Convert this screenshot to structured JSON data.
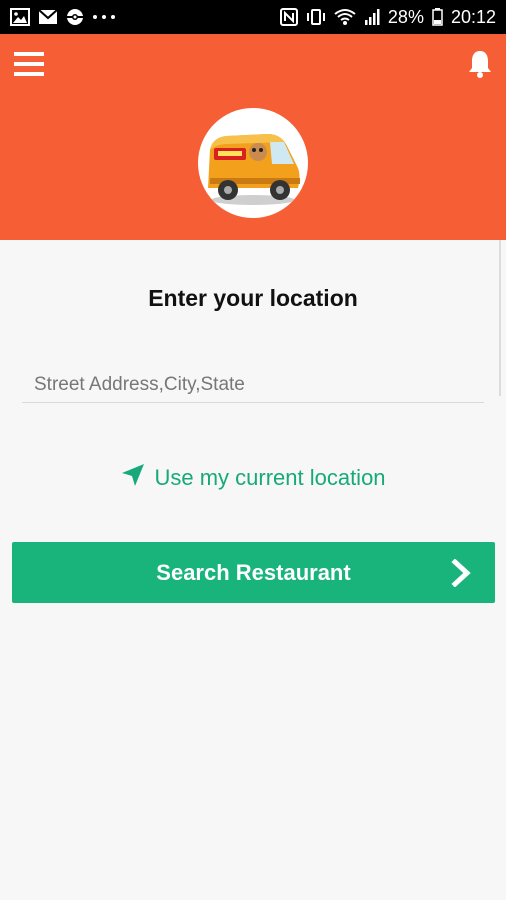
{
  "status_bar": {
    "icons_left": [
      "gallery-icon",
      "mail-icon",
      "pokeball-icon",
      "more-icon"
    ],
    "icons_right": [
      "nfc-icon",
      "vibrate-icon",
      "wifi-icon",
      "signal-icon",
      "battery-icon"
    ],
    "battery": "28%",
    "time": "20:12"
  },
  "header": {
    "background": "#f65f36",
    "menu_icon": "hamburger-menu-icon",
    "notification_icon": "bell-icon",
    "logo": "food-delivery-van-logo"
  },
  "main": {
    "title": "Enter your location",
    "address_input": {
      "value": "",
      "placeholder": "Street Address,City,State"
    },
    "current_location_link": {
      "icon": "navigation-arrow-icon",
      "label": "Use my current location"
    },
    "search_button": {
      "label": "Search Restaurant",
      "icon": "chevron-right-icon"
    }
  },
  "colors": {
    "accent": "#19b47c",
    "link": "#18a97a",
    "brand": "#f65f36"
  }
}
